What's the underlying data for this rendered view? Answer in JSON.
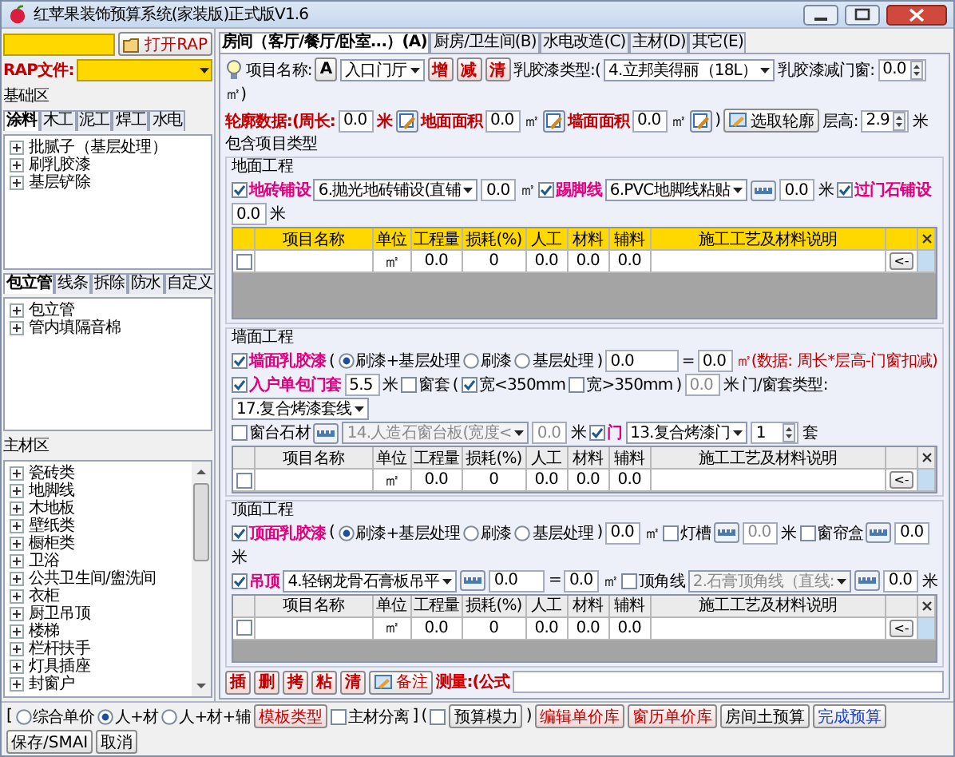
{
  "window": {
    "title": "红苹果装饰预算系统(家装版)正式版V1.6"
  },
  "left": {
    "open_button": "打开RAP",
    "rap_file_label": "RAP文件:",
    "base_area_label": "基础区",
    "base_tabs": [
      {
        "label": "涂料",
        "selected": true
      },
      {
        "label": "木工",
        "selected": false
      },
      {
        "label": "泥工",
        "selected": false
      },
      {
        "label": "焊工",
        "selected": false
      },
      {
        "label": "水电",
        "selected": false
      }
    ],
    "base_tree": [
      {
        "label": "批腻子（基层处理）",
        "expanded": false
      },
      {
        "label": "刷乳胶漆",
        "expanded": false
      },
      {
        "label": "基层铲除",
        "expanded": false
      }
    ],
    "extra_tabs": [
      {
        "label": "包立管",
        "selected": true
      },
      {
        "label": "线条",
        "selected": false
      },
      {
        "label": "拆除",
        "selected": false
      },
      {
        "label": "防水",
        "selected": false
      },
      {
        "label": "自定义",
        "selected": false
      }
    ],
    "extra_tree": [
      {
        "label": "包立管",
        "expanded": false
      },
      {
        "label": "管内填隔音棉",
        "expanded": false
      }
    ],
    "material_area_label": "主材区",
    "materials": [
      {
        "label": "瓷砖类",
        "expanded": false
      },
      {
        "label": "地脚线",
        "expanded": false
      },
      {
        "label": "木地板",
        "expanded": false
      },
      {
        "label": "壁纸类",
        "expanded": false
      },
      {
        "label": "橱柜类",
        "expanded": false
      },
      {
        "label": "卫浴",
        "expanded": false
      },
      {
        "label": "公共卫生间/盥洗间",
        "expanded": false
      },
      {
        "label": "衣柜",
        "expanded": false
      },
      {
        "label": "厨卫吊顶",
        "expanded": false
      },
      {
        "label": "楼梯",
        "expanded": false
      },
      {
        "label": "栏杆扶手",
        "expanded": false
      },
      {
        "label": "灯具插座",
        "expanded": false
      },
      {
        "label": "封窗户",
        "expanded": false
      }
    ]
  },
  "right": {
    "tabs": [
      {
        "label": "房间（客厅/餐厅/卧室...）(A)",
        "selected": true
      },
      {
        "label": "厨房/卫生间(B)",
        "selected": false
      },
      {
        "label": "水电改造(C)",
        "selected": false
      },
      {
        "label": "主材(D)",
        "selected": false
      },
      {
        "label": "其它(E)",
        "selected": false
      }
    ],
    "toolbar_lines": [
      [
        {
          "kind": "bulb"
        },
        {
          "kind": "text",
          "text": "项目名称:"
        },
        {
          "kind": "button",
          "text": "A",
          "color": "#000000"
        },
        {
          "kind": "combo",
          "value": "入口门厅",
          "disabled": false
        },
        {
          "kind": "button",
          "text": "增",
          "color": "#c00000"
        },
        {
          "kind": "button",
          "text": "减",
          "color": "#c00000"
        },
        {
          "kind": "button",
          "text": "清",
          "color": "#c00000"
        },
        {
          "kind": "text",
          "text": "乳胶漆类型:("
        },
        {
          "kind": "combo",
          "value": "4.立邦美得丽（18L）",
          "disabled": false
        },
        {
          "kind": "text",
          "text": "乳胶漆减门窗:"
        },
        {
          "kind": "spin",
          "value": "0.0",
          "disabled": false
        },
        {
          "kind": "text",
          "text": "㎡)"
        }
      ],
      [
        {
          "kind": "caption",
          "text": "轮廓数据:(周长:"
        },
        {
          "kind": "input",
          "value": "0.0",
          "disabled": false
        },
        {
          "kind": "caption",
          "text": "米"
        },
        {
          "kind": "picker"
        },
        {
          "kind": "caption",
          "text": "地面面积"
        },
        {
          "kind": "input",
          "value": "0.0",
          "disabled": false
        },
        {
          "kind": "text",
          "text": "㎡"
        },
        {
          "kind": "picker"
        },
        {
          "kind": "caption",
          "text": "墙面面积"
        },
        {
          "kind": "input",
          "value": "0.0",
          "disabled": false
        },
        {
          "kind": "text",
          "text": "㎡"
        },
        {
          "kind": "picker"
        },
        {
          "kind": "text",
          "text": ")"
        },
        {
          "kind": "iconbutton",
          "text": "选取轮廓",
          "color": "#000000"
        },
        {
          "kind": "text",
          "text": "层高:"
        },
        {
          "kind": "spin",
          "value": "2.9",
          "disabled": false
        },
        {
          "kind": "text",
          "text": "米"
        }
      ]
    ],
    "sections_caption": "包含项目类型",
    "sections": [
      {
        "title": "地面工程",
        "color": "#ffd800",
        "control_lines": [
          [
            {
              "kind": "check",
              "text": "地砖铺设",
              "checked": true
            },
            {
              "kind": "combo",
              "value": "6.抛光地砖铺设(直铺",
              "disabled": false
            },
            {
              "kind": "input",
              "value": "0.0",
              "disabled": false
            },
            {
              "kind": "text",
              "text": "㎡"
            },
            {
              "kind": "check",
              "text": "踢脚线",
              "checked": true
            },
            {
              "kind": "combo",
              "value": "6.PVC地脚线粘贴",
              "disabled": false
            },
            {
              "kind": "ruler"
            },
            {
              "kind": "input",
              "value": "0.0",
              "disabled": false
            },
            {
              "kind": "text",
              "text": "米"
            },
            {
              "kind": "check",
              "text": "过门石铺设",
              "checked": true
            },
            {
              "kind": "input",
              "value": "0.0",
              "disabled": false
            },
            {
              "kind": "text",
              "text": "米"
            }
          ]
        ],
        "table": {
          "columns": [
            "项目名称",
            "单位",
            "工程量",
            "损耗(%)",
            "人工",
            "材料",
            "辅料",
            "施工工艺及材料说明"
          ],
          "rows": [
            {
              "checked": false,
              "unit": "㎡",
              "quantity": "0.0",
              "loss": "0",
              "labor": "0.0",
              "material": "0.0",
              "auxiliary": "0.0",
              "action": "<-"
            }
          ]
        }
      },
      {
        "title": "墙面工程",
        "color": "#ebebeb",
        "control_lines": [
          [
            {
              "kind": "check",
              "text": "墙面乳胶漆",
              "checked": true
            },
            {
              "kind": "text",
              "text": "("
            },
            {
              "kind": "radio",
              "text": "刷漆+基层处理",
              "selected": true
            },
            {
              "kind": "radio",
              "text": "刷漆",
              "selected": false
            },
            {
              "kind": "radio",
              "text": "基层处理",
              "selected": false
            },
            {
              "kind": "text",
              "text": ")"
            },
            {
              "kind": "field",
              "value": "0.0",
              "disabled": false
            },
            {
              "kind": "text",
              "text": "="
            },
            {
              "kind": "input",
              "value": "0.0",
              "disabled": false
            },
            {
              "kind": "note",
              "text": "㎡(数据: 周长*层高-门窗扣减)"
            }
          ],
          [
            {
              "kind": "check",
              "text": "入户单包门套",
              "checked": true
            },
            {
              "kind": "input",
              "value": "5.5",
              "disabled": false
            },
            {
              "kind": "text",
              "text": "米"
            },
            {
              "kind": "check",
              "text": "窗套",
              "checked": false
            },
            {
              "kind": "text",
              "text": "("
            },
            {
              "kind": "option",
              "text": "宽<350mm",
              "checked": true
            },
            {
              "kind": "option",
              "text": "宽>350mm",
              "checked": false
            },
            {
              "kind": "text",
              "text": ")"
            },
            {
              "kind": "input",
              "value": "0.0",
              "disabled": true
            },
            {
              "kind": "text",
              "text": "米"
            },
            {
              "kind": "text",
              "text": "门/窗套类型:"
            },
            {
              "kind": "combo",
              "value": "17.复合烤漆套线",
              "disabled": false
            }
          ],
          [
            {
              "kind": "check",
              "text": "窗台石材",
              "checked": false
            },
            {
              "kind": "ruler"
            },
            {
              "kind": "combo",
              "value": "14.人造石窗台板(宽度<",
              "disabled": true
            },
            {
              "kind": "input",
              "value": "0.0",
              "disabled": true
            },
            {
              "kind": "text",
              "text": "米"
            },
            {
              "kind": "check",
              "text": "门",
              "checked": true
            },
            {
              "kind": "combo",
              "value": "13.复合烤漆门",
              "disabled": false
            },
            {
              "kind": "spin",
              "value": "1",
              "disabled": false
            },
            {
              "kind": "text",
              "text": "套"
            }
          ]
        ],
        "table": {
          "columns": [
            "项目名称",
            "单位",
            "工程量",
            "损耗(%)",
            "人工",
            "材料",
            "辅料",
            "施工工艺及材料说明"
          ],
          "rows": [
            {
              "checked": false,
              "unit": "㎡",
              "quantity": "0.0",
              "loss": "0",
              "labor": "0.0",
              "material": "0.0",
              "auxiliary": "0.0",
              "action": "<-"
            }
          ]
        }
      },
      {
        "title": "顶面工程",
        "color": "#ebebeb",
        "control_lines": [
          [
            {
              "kind": "check",
              "text": "顶面乳胶漆",
              "checked": true
            },
            {
              "kind": "text",
              "text": "("
            },
            {
              "kind": "radio",
              "text": "刷漆+基层处理",
              "selected": true
            },
            {
              "kind": "radio",
              "text": "刷漆",
              "selected": false
            },
            {
              "kind": "radio",
              "text": "基层处理",
              "selected": false
            },
            {
              "kind": "text",
              "text": ")"
            },
            {
              "kind": "input",
              "value": "0.0",
              "disabled": false
            },
            {
              "kind": "text",
              "text": "㎡"
            },
            {
              "kind": "check",
              "text": "灯槽",
              "checked": false
            },
            {
              "kind": "ruler"
            },
            {
              "kind": "input",
              "value": "0.0",
              "disabled": true
            },
            {
              "kind": "text",
              "text": "米"
            },
            {
              "kind": "check",
              "text": "窗帘盒",
              "checked": false
            },
            {
              "kind": "ruler"
            },
            {
              "kind": "input",
              "value": "0.0",
              "disabled": false
            },
            {
              "kind": "text",
              "text": "米"
            }
          ],
          [
            {
              "kind": "check",
              "text": "吊顶",
              "checked": true
            },
            {
              "kind": "combo",
              "value": "4.轻钢龙骨石膏板吊平",
              "disabled": false
            },
            {
              "kind": "ruler"
            },
            {
              "kind": "field",
              "value": "0.0",
              "disabled": false
            },
            {
              "kind": "text",
              "text": "="
            },
            {
              "kind": "input",
              "value": "0.0",
              "disabled": false
            },
            {
              "kind": "text",
              "text": "㎡"
            },
            {
              "kind": "check",
              "text": "顶角线",
              "checked": false
            },
            {
              "kind": "combo",
              "value": "2.石膏顶角线（直线:",
              "disabled": true
            },
            {
              "kind": "ruler"
            },
            {
              "kind": "input",
              "value": "0.0",
              "disabled": false
            },
            {
              "kind": "text",
              "text": "米"
            }
          ]
        ],
        "table": {
          "columns": [
            "项目名称",
            "单位",
            "工程量",
            "损耗(%)",
            "人工",
            "材料",
            "辅料",
            "施工工艺及材料说明"
          ],
          "rows": [
            {
              "checked": false,
              "unit": "㎡",
              "quantity": "0.0",
              "loss": "0",
              "labor": "0.0",
              "material": "0.0",
              "auxiliary": "0.0",
              "action": "<-"
            }
          ]
        }
      }
    ],
    "actions": [
      {
        "kind": "button",
        "text": "插",
        "color": "#c00000"
      },
      {
        "kind": "button",
        "text": "删",
        "color": "#c00000"
      },
      {
        "kind": "button",
        "text": "拷",
        "color": "#c00000"
      },
      {
        "kind": "button",
        "text": "粘",
        "color": "#c00000"
      },
      {
        "kind": "button",
        "text": "清",
        "color": "#c00000"
      },
      {
        "kind": "iconbutton",
        "text": "备注",
        "color": "#c00000"
      },
      {
        "kind": "caption",
        "text": "测量:(公式"
      },
      {
        "kind": "field"
      }
    ]
  },
  "bottom_bar": [
    {
      "kind": "text",
      "text": "["
    },
    {
      "kind": "radio",
      "text": "综合单价",
      "selected": false
    },
    {
      "kind": "radio",
      "text": "人+材",
      "selected": true
    },
    {
      "kind": "radio",
      "text": "人+材+辅",
      "selected": false
    },
    {
      "kind": "button",
      "text": "模板类型",
      "color": "#c00000"
    },
    {
      "kind": "option",
      "text": "主材分离",
      "checked": false
    },
    {
      "kind": "text",
      "text": "]"
    },
    {
      "kind": "text",
      "text": "("
    },
    {
      "kind": "option",
      "checked": false
    },
    {
      "kind": "button",
      "text": "预算模力",
      "color": "#000000"
    },
    {
      "kind": "text",
      "text": ")"
    },
    {
      "kind": "button",
      "text": "编辑单价库",
      "color": "#c00000"
    },
    {
      "kind": "button",
      "text": "窗历单价库",
      "color": "#c00000"
    },
    {
      "kind": "button",
      "text": "房间土预算",
      "color": "#000000"
    },
    {
      "kind": "button",
      "text": "完成预算",
      "color": "#1a3fc0"
    },
    {
      "kind": "button",
      "text": "保存/SMAI",
      "color": "#000000"
    },
    {
      "kind": "button",
      "text": "取消",
      "color": "#000000"
    }
  ]
}
